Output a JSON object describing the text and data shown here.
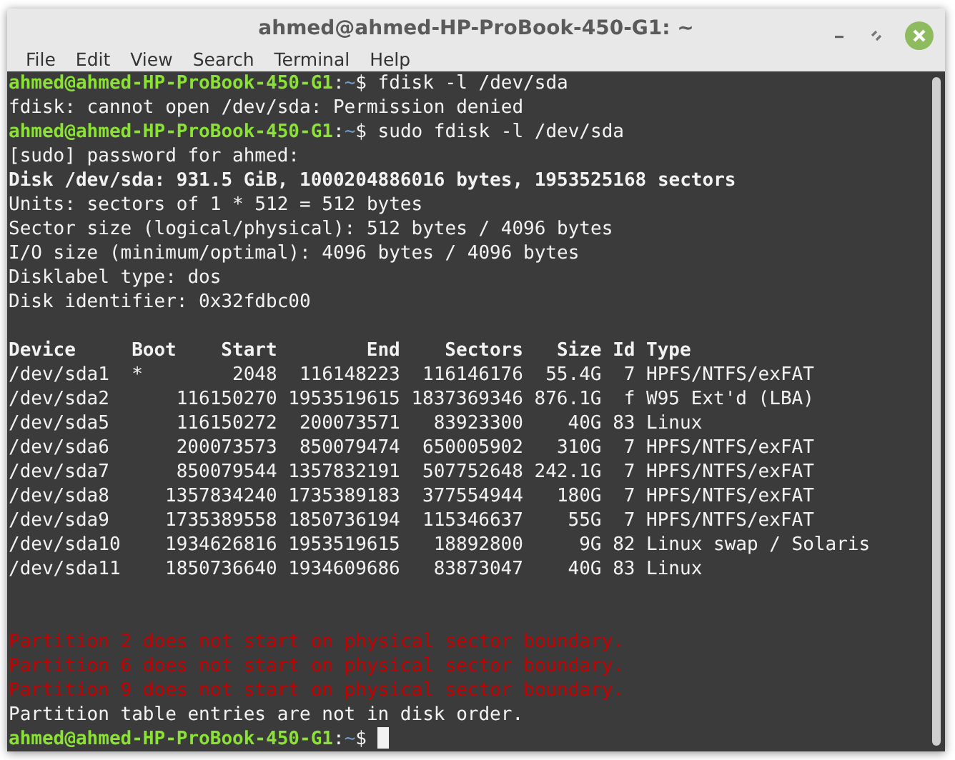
{
  "window": {
    "title": "ahmed@ahmed-HP-ProBook-450-G1: ~"
  },
  "menu": [
    "File",
    "Edit",
    "View",
    "Search",
    "Terminal",
    "Help"
  ],
  "terminal": {
    "lines_before": [
      {
        "kind": "prompt",
        "user": "ahmed@ahmed-HP-ProBook-450-G1",
        "sep": ":",
        "path": "~",
        "symbol": "$",
        "command": "fdisk -l /dev/sda"
      },
      {
        "kind": "output",
        "text": "fdisk: cannot open /dev/sda: Permission denied"
      },
      {
        "kind": "prompt",
        "user": "ahmed@ahmed-HP-ProBook-450-G1",
        "sep": ":",
        "path": "~",
        "symbol": "$",
        "command": "sudo fdisk -l /dev/sda"
      },
      {
        "kind": "output",
        "text": "[sudo] password for ahmed:"
      },
      {
        "kind": "bold",
        "text": "Disk /dev/sda: 931.5 GiB, 1000204886016 bytes, 1953525168 sectors"
      },
      {
        "kind": "output",
        "text": "Units: sectors of 1 * 512 = 512 bytes"
      },
      {
        "kind": "output",
        "text": "Sector size (logical/physical): 512 bytes / 4096 bytes"
      },
      {
        "kind": "output",
        "text": "I/O size (minimum/optimal): 4096 bytes / 4096 bytes"
      },
      {
        "kind": "output",
        "text": "Disklabel type: dos"
      },
      {
        "kind": "output",
        "text": "Disk identifier: 0x32fdbc00"
      }
    ],
    "partition_table": {
      "columns": [
        "Device",
        "Boot",
        "Start",
        "End",
        "Sectors",
        "Size",
        "Id",
        "Type"
      ],
      "rows": [
        [
          "/dev/sda1",
          "*",
          "2048",
          "116148223",
          "116146176",
          "55.4G",
          "7",
          "HPFS/NTFS/exFAT"
        ],
        [
          "/dev/sda2",
          "",
          "116150270",
          "1953519615",
          "1837369346",
          "876.1G",
          "f",
          "W95 Ext'd (LBA)"
        ],
        [
          "/dev/sda5",
          "",
          "116150272",
          "200073571",
          "83923300",
          "40G",
          "83",
          "Linux"
        ],
        [
          "/dev/sda6",
          "",
          "200073573",
          "850079474",
          "650005902",
          "310G",
          "7",
          "HPFS/NTFS/exFAT"
        ],
        [
          "/dev/sda7",
          "",
          "850079544",
          "1357832191",
          "507752648",
          "242.1G",
          "7",
          "HPFS/NTFS/exFAT"
        ],
        [
          "/dev/sda8",
          "",
          "1357834240",
          "1735389183",
          "377554944",
          "180G",
          "7",
          "HPFS/NTFS/exFAT"
        ],
        [
          "/dev/sda9",
          "",
          "1735389558",
          "1850736194",
          "115346637",
          "55G",
          "7",
          "HPFS/NTFS/exFAT"
        ],
        [
          "/dev/sda10",
          "",
          "1934626816",
          "1953519615",
          "18892800",
          "9G",
          "82",
          "Linux swap / Solaris"
        ],
        [
          "/dev/sda11",
          "",
          "1850736640",
          "1934609686",
          "83873047",
          "40G",
          "83",
          "Linux"
        ]
      ]
    },
    "lines_after": [
      {
        "kind": "error",
        "text": "Partition 2 does not start on physical sector boundary."
      },
      {
        "kind": "error",
        "text": "Partition 6 does not start on physical sector boundary."
      },
      {
        "kind": "error",
        "text": "Partition 9 does not start on physical sector boundary."
      },
      {
        "kind": "output",
        "text": "Partition table entries are not in disk order."
      },
      {
        "kind": "prompt",
        "user": "ahmed@ahmed-HP-ProBook-450-G1",
        "sep": ":",
        "path": "~",
        "symbol": "$"
      }
    ]
  }
}
